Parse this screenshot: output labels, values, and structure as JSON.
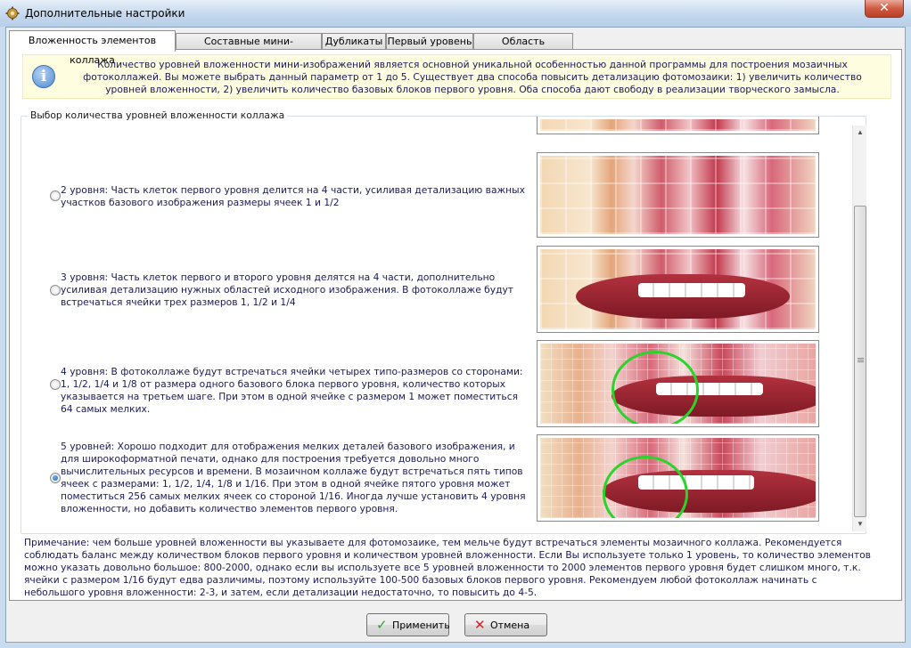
{
  "window": {
    "title": "Дополнительные настройки",
    "close_glyph": "✕"
  },
  "tabs": [
    {
      "label": "Вложенность элементов коллажа",
      "active": true
    },
    {
      "label": "Составные мини-изображения",
      "active": false
    },
    {
      "label": "Дубликаты",
      "active": false
    },
    {
      "label": "Первый уровень",
      "active": false
    },
    {
      "label": "Область заполнения",
      "active": false
    }
  ],
  "info": {
    "icon": "info-icon",
    "text": "Количество уровней вложенности мини-изображений является основной уникальной особенностью данной программы для построения мозаичных фотоколлажей. Вы можете выбрать данный параметр от 1 до 5. Существует два способа повысить детализацию фотомозаики: 1) увеличить количество уровней вложенности, 2) увеличить количество базовых блоков первого уровня. Оба способа дают свободу в реализации творческого замысла."
  },
  "group": {
    "legend": "Выбор количества уровней вложенности коллажа",
    "options": [
      {
        "text": "2 уровня: Часть клеток первого уровня делится на 4 части, усиливая детализацию важных участков базового изображения размеры ячеек 1 и 1/2",
        "checked": false
      },
      {
        "text": "3 уровня: Часть клеток первого и второго уровня делятся на 4 части, дополнительно усиливая детализацию нужных областей исходного изображения. В фотоколлаже будут встречаться ячейки трех размеров 1, 1/2 и 1/4",
        "checked": false
      },
      {
        "text": "4 уровня: В фотоколлаже будут встречаться ячейки четырех типо-размеров со сторонами: 1, 1/2, 1/4 и 1/8 от размера одного базового блока первого уровня, количество которых указывается на третьем шаге. При этом в одной ячейке с размером 1 может поместиться 64 самых мелких.",
        "checked": false
      },
      {
        "text": "5 уровней: Хорошо подходит для отображения мелких деталей базового изображения, и для широкоформатной печати, однако для построения требуется довольно много вычислительных ресурсов и времени. В мозаичном коллаже будут встречаться пять типов ячеек с размерами: 1, 1/2, 1/4, 1/8 и 1/16. При этом в одной ячейке пятого уровня может поместиться 256 самых мелких ячеек со стороной 1/16. Иногда лучше установить 4 уровня вложенности, но добавить количество элементов первого уровня.",
        "checked": true
      }
    ]
  },
  "note": "Примечание: чем больше уровней вложенности вы указываете для фотомозаике, тем мельче будут встречаться элементы мозаичного коллажа. Рекомендуется соблюдать баланс между количеством блоков первого уровня и количеством уровней вложенности. Если Вы используете только 1 уровень, то количество элементов можно указать довольно большое: 800-2000, однако если вы используете все 5 уровней вложенности то 2000 элементов первого уровня будет слишком много, т.к. ячейки с размером 1/16 будут едва различимы, поэтому используйте 100-500 базовых блоков первого уровня. Рекомендуем любой фотоколлаж начинать с небольшого уровня вложенности: 2-3, и затем, если детализации недостаточно, то повысить до 4-5.",
  "buttons": {
    "apply_label": "Применить",
    "cancel_label": "Отмена",
    "apply_icon": "checkmark-icon",
    "cancel_icon": "cross-icon"
  },
  "colors": {
    "info_bg": "#fffde0",
    "ring": "#2bd42b",
    "apply_check": "#2aa52a",
    "cancel_cross": "#d0242c"
  }
}
